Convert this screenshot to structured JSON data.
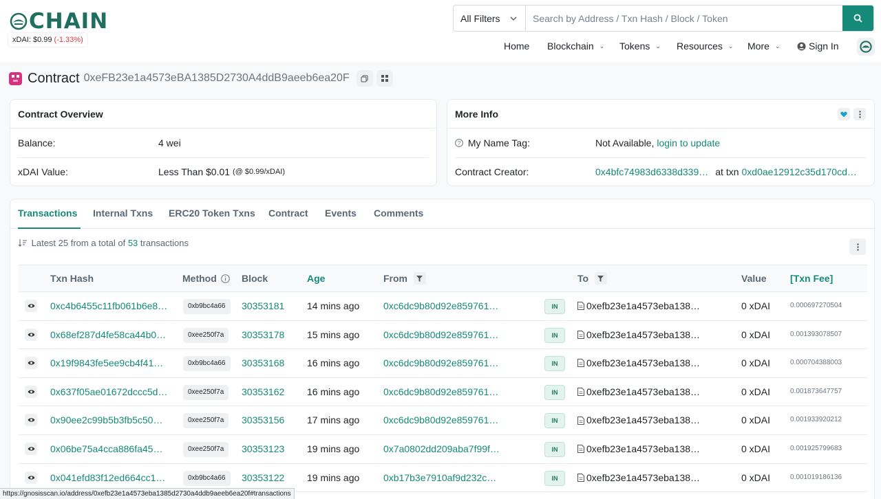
{
  "brand": {
    "logo_text": "CHAIN",
    "price_label": "xDAI: $0.99",
    "price_change": "(-1.33%)"
  },
  "search": {
    "filter_label": "All Filters",
    "placeholder": "Search by Address / Txn Hash / Block / Token"
  },
  "nav": {
    "home": "Home",
    "blockchain": "Blockchain",
    "tokens": "Tokens",
    "resources": "Resources",
    "more": "More",
    "signin": "Sign In"
  },
  "contract": {
    "title": "Contract",
    "address": "0xeFB23e1a4573eBA1385D2730A4ddB9aeeb6ea20F"
  },
  "overview": {
    "heading": "Contract Overview",
    "balance_label": "Balance:",
    "balance_value": "4 wei",
    "value_label": "xDAI Value:",
    "value_value": "Less Than $0.01",
    "value_note": "(@ $0.99/xDAI)"
  },
  "moreinfo": {
    "heading": "More Info",
    "nametag_label": "My Name Tag:",
    "nametag_value": "Not Available,",
    "nametag_link": "login to update",
    "creator_label": "Contract Creator:",
    "creator_addr": "0x4bfc74983d6338d339…",
    "creator_at": "at txn",
    "creator_txn": "0xd0ae12912c35d170cd…"
  },
  "tabs": [
    "Transactions",
    "Internal Txns",
    "ERC20 Token Txns",
    "Contract",
    "Events",
    "Comments"
  ],
  "summary": {
    "prefix": "Latest 25 from a total of",
    "count": "53",
    "suffix": "transactions"
  },
  "columns": {
    "hash": "Txn Hash",
    "method": "Method",
    "block": "Block",
    "age": "Age",
    "from": "From",
    "to": "To",
    "value": "Value",
    "fee": "[Txn Fee]"
  },
  "rows": [
    {
      "hash": "0xc4b6455c11fb061b6e8…",
      "method": "0xb9bc4a66",
      "block": "30353181",
      "age": "14 mins ago",
      "from": "0xc6dc9b80d92e859761…",
      "dir": "IN",
      "to": "0xefb23e1a4573eba138…",
      "value": "0 xDAI",
      "fee": "0.000697270504"
    },
    {
      "hash": "0x68ef287d4fe58ca44b0…",
      "method": "0xee250f7a",
      "block": "30353178",
      "age": "15 mins ago",
      "from": "0xc6dc9b80d92e859761…",
      "dir": "IN",
      "to": "0xefb23e1a4573eba138…",
      "value": "0 xDAI",
      "fee": "0.001393078507"
    },
    {
      "hash": "0x19f9843fe5ee9cb4f41…",
      "method": "0xb9bc4a66",
      "block": "30353168",
      "age": "16 mins ago",
      "from": "0xc6dc9b80d92e859761…",
      "dir": "IN",
      "to": "0xefb23e1a4573eba138…",
      "value": "0 xDAI",
      "fee": "0.000704388003"
    },
    {
      "hash": "0x637f05ae01672dccc5d…",
      "method": "0xee250f7a",
      "block": "30353162",
      "age": "16 mins ago",
      "from": "0xc6dc9b80d92e859761…",
      "dir": "IN",
      "to": "0xefb23e1a4573eba138…",
      "value": "0 xDAI",
      "fee": "0.001873647757"
    },
    {
      "hash": "0x90ee2c99b5b3fb5c50…",
      "method": "0xee250f7a",
      "block": "30353156",
      "age": "17 mins ago",
      "from": "0xc6dc9b80d92e859761…",
      "dir": "IN",
      "to": "0xefb23e1a4573eba138…",
      "value": "0 xDAI",
      "fee": "0.001933920212"
    },
    {
      "hash": "0x06be75a4cca886fa45…",
      "method": "0xee250f7a",
      "block": "30353123",
      "age": "19 mins ago",
      "from": "0x7a0802dd209aba7f99f…",
      "dir": "IN",
      "to": "0xefb23e1a4573eba138…",
      "value": "0 xDAI",
      "fee": "0.001925799683"
    },
    {
      "hash": "0x041efd83f12ed664cc1…",
      "method": "0xb9bc4a66",
      "block": "30353122",
      "age": "19 mins ago",
      "from": "0xb17b3e7910af9d232c…",
      "dir": "IN",
      "to": "0xefb23e1a4573eba138…",
      "value": "0 xDAI",
      "fee": "0.001019186136"
    }
  ],
  "status_url": "https://gnosisscan.io/address/0xefb23e1a4573eba1385d2730a4ddb9aeeb6ea20f#transactions"
}
